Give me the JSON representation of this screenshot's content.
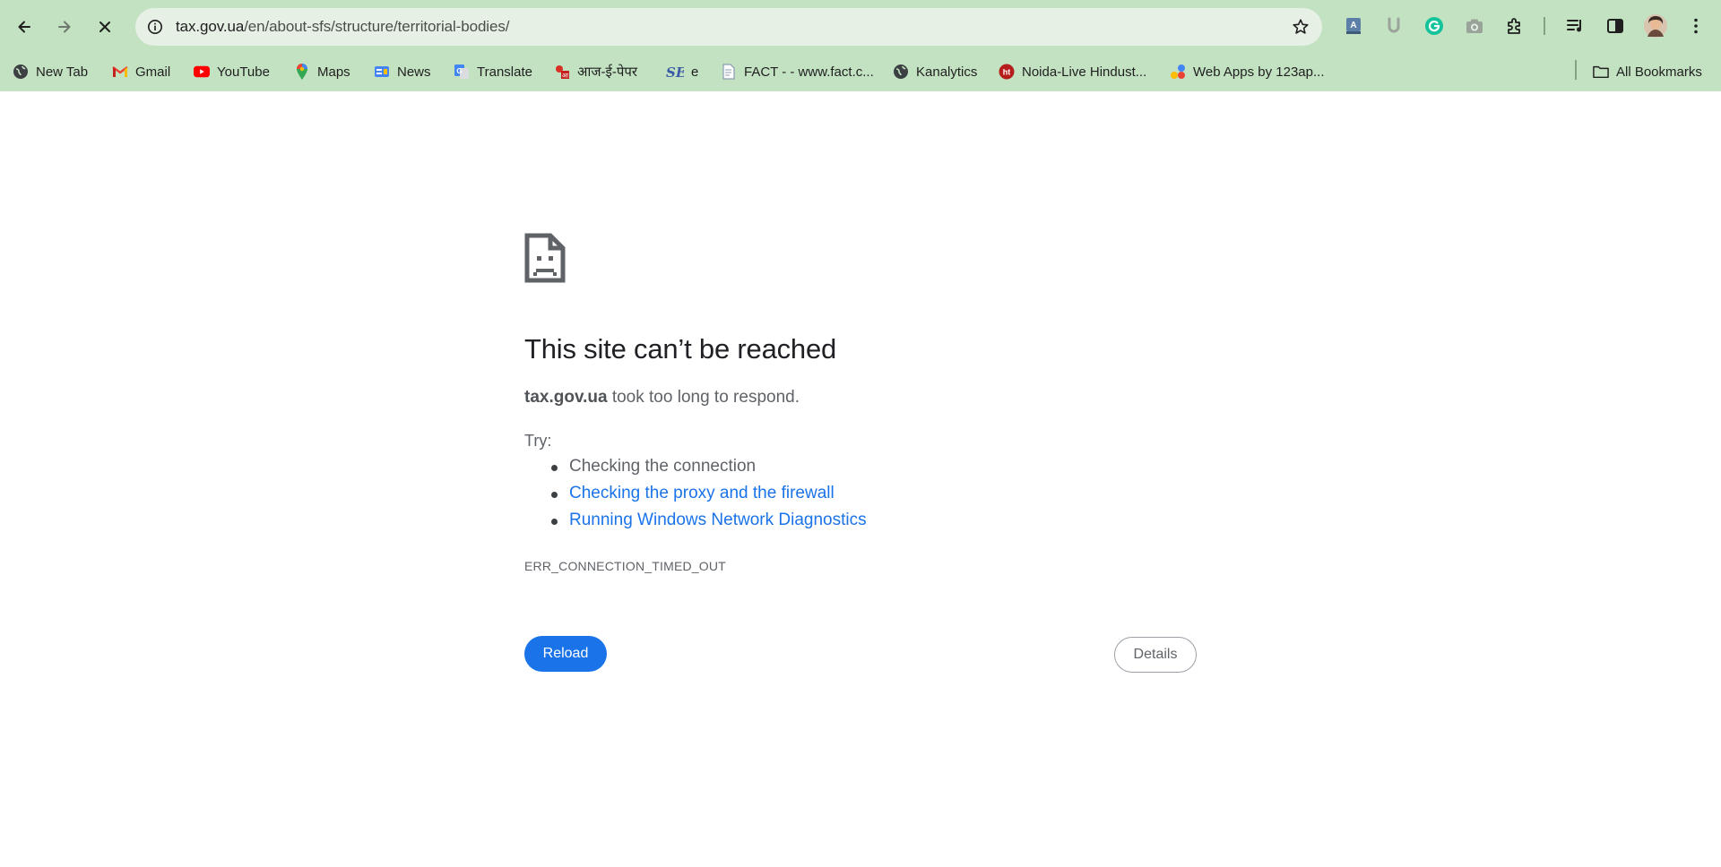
{
  "browser": {
    "url": {
      "domain": "tax.gov.ua",
      "path": "/en/about-sfs/structure/territorial-bodies/"
    },
    "icons": {
      "back": "back-arrow-icon",
      "forward": "forward-arrow-icon",
      "stop": "close-icon",
      "site_info": "site-info-icon",
      "bookmark_star": "star-icon",
      "extensions": [
        "translate-extension-icon",
        "u-extension-icon",
        "grammarly-icon",
        "camera-icon",
        "puzzle-extensions-icon",
        "reading-list-icon",
        "side-panel-icon",
        "profile-avatar",
        "more-menu-icon"
      ]
    },
    "theme_color": "#c3e2c2"
  },
  "bookmarks": {
    "items": [
      {
        "label": "New Tab",
        "icon": "globe-icon"
      },
      {
        "label": "Gmail",
        "icon": "gmail-icon"
      },
      {
        "label": "YouTube",
        "icon": "youtube-icon"
      },
      {
        "label": "Maps",
        "icon": "maps-pin-icon"
      },
      {
        "label": "News",
        "icon": "news-icon"
      },
      {
        "label": "Translate",
        "icon": "translate-icon"
      },
      {
        "label": "आज-ई-पेपर",
        "icon": "aaj-icon"
      },
      {
        "label": "e",
        "icon": "se-icon"
      },
      {
        "label": "FACT - - www.fact.c...",
        "icon": "document-icon"
      },
      {
        "label": "Kanalytics",
        "icon": "globe-icon"
      },
      {
        "label": "Noida-Live Hindust...",
        "icon": "ht-icon"
      },
      {
        "label": "Web Apps by 123ap...",
        "icon": "apps-icon"
      }
    ],
    "all_bookmarks": "All Bookmarks"
  },
  "error_page": {
    "icon": "sad-page-icon",
    "title": "This site can’t be reached",
    "host": "tax.gov.ua",
    "description": " took too long to respond.",
    "try_label": "Try:",
    "suggestions": [
      {
        "text": "Checking the connection",
        "link": false
      },
      {
        "text": "Checking the proxy and the firewall",
        "link": true
      },
      {
        "text": "Running Windows Network Diagnostics",
        "link": true
      }
    ],
    "error_code": "ERR_CONNECTION_TIMED_OUT",
    "reload_label": "Reload",
    "details_label": "Details",
    "accent_color": "#1a73e8"
  }
}
